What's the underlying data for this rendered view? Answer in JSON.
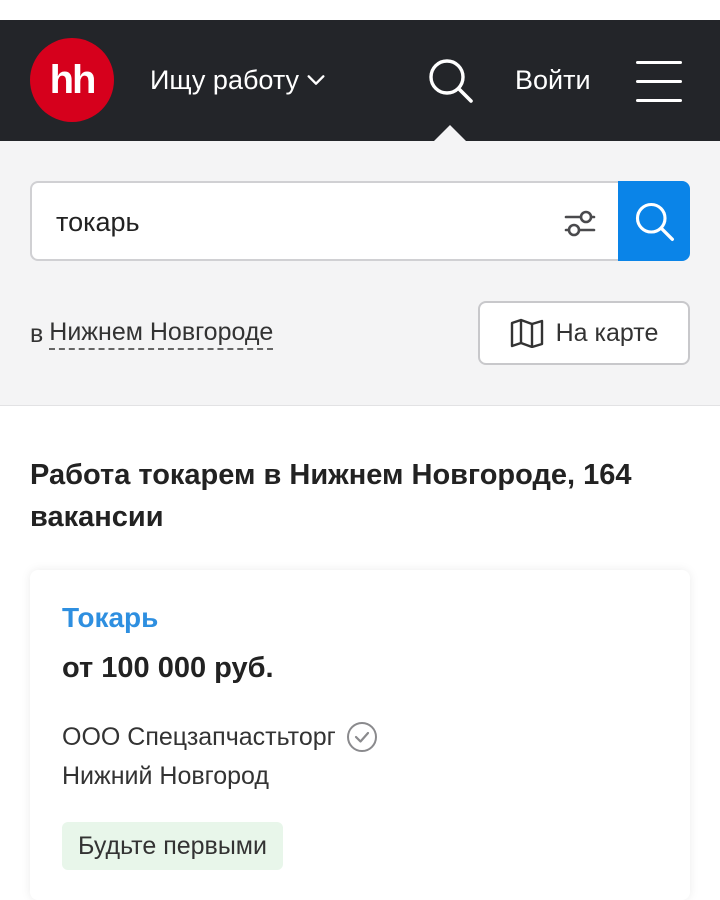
{
  "header": {
    "logo_text": "hh",
    "mode_label": "Ищу работу",
    "login_label": "Войти",
    "colors": {
      "background": "#232529",
      "logo": "#d6001c"
    },
    "icons": [
      "chevron-down-icon",
      "search-icon",
      "hamburger-menu-icon"
    ]
  },
  "search": {
    "query": "токарь",
    "region_prefix": "в",
    "region": "Нижнем Новгороде",
    "map_button_label": "На карте",
    "accent_color": "#0a84e8",
    "icons": [
      "filter-settings-icon",
      "search-icon",
      "map-icon"
    ]
  },
  "results": {
    "title": "Работа токарем в Нижнем Новгороде, 164 вакансии"
  },
  "vacancy": {
    "title": "Токарь",
    "salary": "от 100 000 руб.",
    "company": "ООО Спецзапчастьторг",
    "city": "Нижний Новгород",
    "badge": "Будьте первыми",
    "title_color": "#2e8fe0",
    "icons": [
      "verified-check-icon"
    ]
  }
}
